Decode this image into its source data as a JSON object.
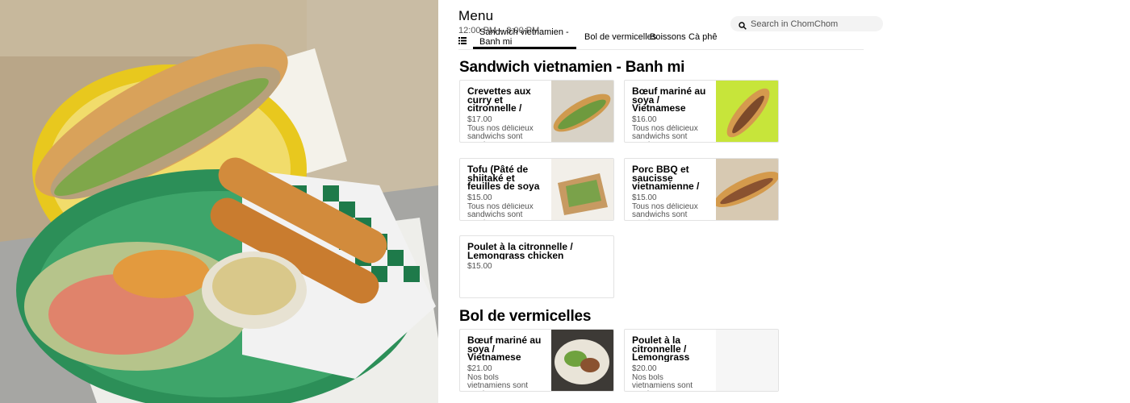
{
  "header": {
    "title": "Menu",
    "hours": "12:00 PM – 8:00 PM"
  },
  "search": {
    "placeholder": "Search in ChomChom"
  },
  "tabs": [
    {
      "label": "Sandwich vietnamien - Banh mi",
      "active": true
    },
    {
      "label": "Bol de vermicelles",
      "active": false
    },
    {
      "label": "Boissons",
      "active": false
    },
    {
      "label": "Cà phê",
      "active": false
    }
  ],
  "sections": [
    {
      "title": "Sandwich vietnamien - Banh mi",
      "items": [
        {
          "name": "Crevettes aux curry et citronnelle / curry and lemongrass shrimps …",
          "price": "$17.00",
          "desc": "Tous nos délicieux sandwichs sont garnis avec…"
        },
        {
          "name": "Bœuf mariné au soya / Vietnamese Shaking Beef (Bo Luc Lac)",
          "price": "$16.00",
          "desc": "Tous nos délicieux sandwichs sont garnis avec…"
        },
        {
          "name": "Tofu (Pâté de shiitaké et feuilles de soya marinées)",
          "price": "$15.00",
          "desc": "Tous nos délicieux sandwichs sont garnis avec…"
        },
        {
          "name": "Porc BBQ et saucisse vietnamienne / BBQ pork and  vietnamese …",
          "price": "$15.00",
          "desc": "Tous nos délicieux sandwichs sont garnis avec…"
        },
        {
          "name": "Poulet à la citronnelle / Lemongrass chicken",
          "price": "$15.00",
          "desc": ""
        }
      ]
    },
    {
      "title": "Bol de vermicelles",
      "items": [
        {
          "name": "Bœuf mariné au soya / Vietnamese Shaking Beef (Bo Luc Lac)",
          "price": "$21.00",
          "desc": "Nos bols vietnamiens sont servis avec vermicelles de…"
        },
        {
          "name": "Poulet à la citronnelle / Lemongrass chicken",
          "price": "$20.00",
          "desc": "Nos bols vietnamiens sont servis avec vermicelles de…"
        }
      ]
    }
  ],
  "colors": {
    "accent": "#000000",
    "muted_text": "#545454",
    "divider": "#e2e2e2",
    "search_bg": "#f3f3f3"
  }
}
